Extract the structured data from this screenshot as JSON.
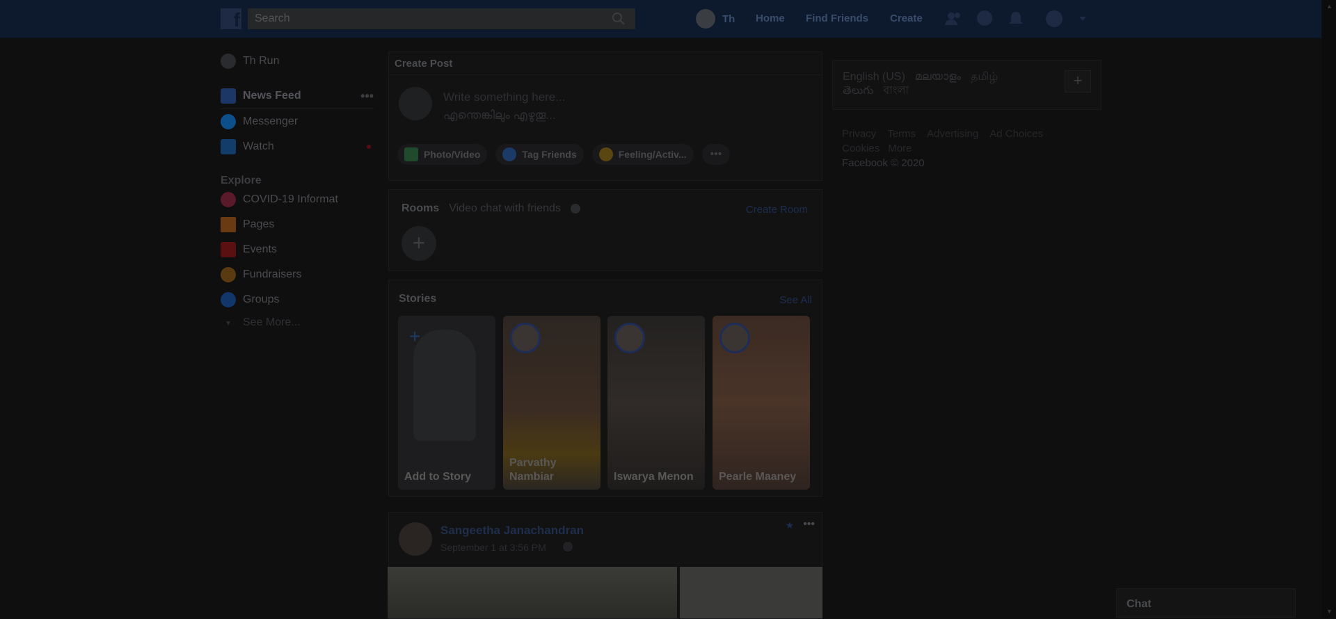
{
  "topbar": {
    "logo_letter": "f",
    "search_placeholder": "Search",
    "user_short": "Th",
    "nav": [
      "Home",
      "Find Friends",
      "Create"
    ]
  },
  "left_nav": {
    "profile": "Th Run",
    "main_items": [
      {
        "label": "News Feed",
        "icon": "news-feed-icon",
        "color": "#1c3666"
      },
      {
        "label": "Messenger",
        "icon": "messenger-icon",
        "color": "#0d4f8a"
      },
      {
        "label": "Watch",
        "icon": "watch-icon",
        "color": "#123d6b"
      }
    ],
    "explore_heading": "Explore",
    "explore_items": [
      {
        "label": "COVID-19 Informat",
        "icon": "covid-info-icon",
        "color": "#5a1a2a"
      },
      {
        "label": "Pages",
        "icon": "pages-icon",
        "color": "#6a3a12"
      },
      {
        "label": "Events",
        "icon": "events-icon",
        "color": "#5a1010"
      },
      {
        "label": "Fundraisers",
        "icon": "fundraisers-icon",
        "color": "#5a3a10"
      },
      {
        "label": "Groups",
        "icon": "groups-icon",
        "color": "#12356b"
      }
    ],
    "see_more": "See More..."
  },
  "create_post": {
    "title": "Create Post",
    "placeholder_line1": "Write something here...",
    "placeholder_line2": "എന്തെങ്കിലും എഴുതൂ...",
    "actions": [
      "Photo/Video",
      "Tag Friends",
      "Feeling/Activ..."
    ]
  },
  "rooms": {
    "title": "Rooms",
    "subtitle": "Video chat with friends",
    "create_label": "Create Room"
  },
  "stories": {
    "title": "Stories",
    "see_all": "See All",
    "items": [
      {
        "name": "Add to Story"
      },
      {
        "name": "Parvathy Nambiar"
      },
      {
        "name": "Iswarya Menon"
      },
      {
        "name": "Pearle Maaney"
      }
    ]
  },
  "post": {
    "author": "Sangeetha Janachandran",
    "timestamp": "September 1 at 3:56 PM"
  },
  "right_col": {
    "languages_line1": [
      "English (US)",
      "മലയാളം",
      "தமிழ்"
    ],
    "languages_line2": [
      "తెలుగు",
      "বাংলা"
    ],
    "footer_line1": [
      "Privacy",
      "Terms",
      "Advertising",
      "Ad Choices"
    ],
    "footer_line2": [
      "Cookies",
      "More"
    ],
    "copyright": "Facebook © 2020"
  },
  "chat": {
    "label": "Chat"
  }
}
